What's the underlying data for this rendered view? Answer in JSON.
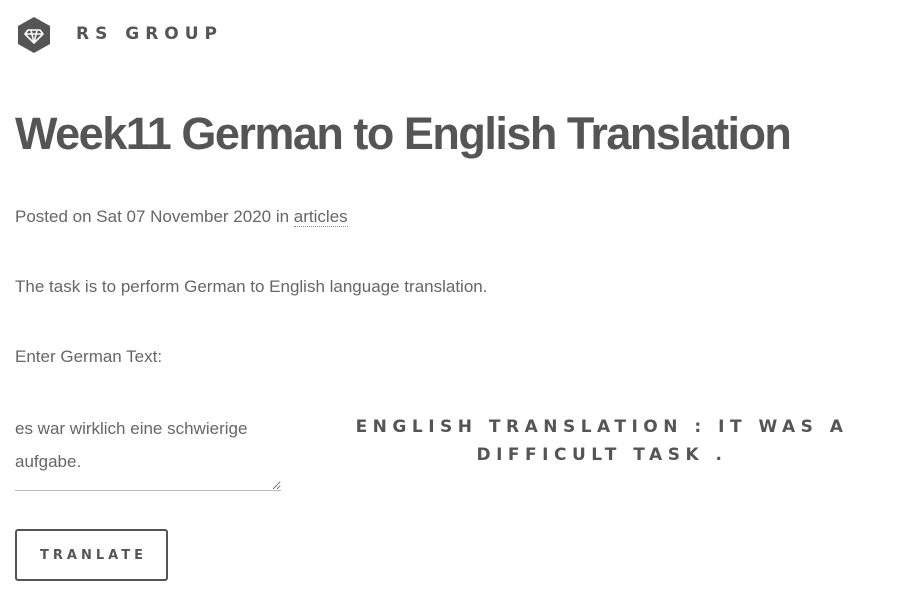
{
  "header": {
    "brand": "RS GROUP",
    "logo_icon": "diamond-hexagon-icon"
  },
  "article": {
    "title": "Week11 German to English Translation",
    "meta_prefix": "Posted on Sat 07 November 2020 in ",
    "category": "articles",
    "task_text": "The task is to perform German to English language translation."
  },
  "form": {
    "input_label": "Enter German Text:",
    "input_value": "es war wirklich eine schwierige aufgabe.",
    "translation_output": "ENGLISH TRANSLATION : IT WAS A DIFFICULT TASK .",
    "submit_label": "TRANLATE"
  },
  "colors": {
    "text": "#555555",
    "background": "#ffffff"
  }
}
